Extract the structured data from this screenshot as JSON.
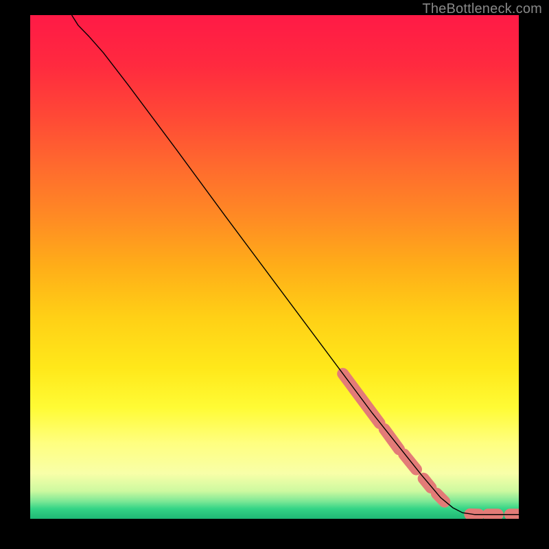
{
  "attribution": "TheBottleneck.com",
  "chart_data": {
    "type": "line",
    "title": "",
    "xlabel": "",
    "ylabel": "",
    "xlim": [
      0,
      100
    ],
    "ylim": [
      0,
      100
    ],
    "background_gradient": {
      "stops": [
        {
          "offset": 0.0,
          "color": "#ff1a46"
        },
        {
          "offset": 0.1,
          "color": "#ff2a3f"
        },
        {
          "offset": 0.2,
          "color": "#ff4836"
        },
        {
          "offset": 0.3,
          "color": "#ff6a2e"
        },
        {
          "offset": 0.4,
          "color": "#ff8a24"
        },
        {
          "offset": 0.5,
          "color": "#ffae18"
        },
        {
          "offset": 0.6,
          "color": "#ffd016"
        },
        {
          "offset": 0.7,
          "color": "#ffe81a"
        },
        {
          "offset": 0.78,
          "color": "#fffb35"
        },
        {
          "offset": 0.85,
          "color": "#ffff80"
        },
        {
          "offset": 0.91,
          "color": "#f8ffa8"
        },
        {
          "offset": 0.945,
          "color": "#cdf9a0"
        },
        {
          "offset": 0.965,
          "color": "#7ee896"
        },
        {
          "offset": 0.98,
          "color": "#34d486"
        },
        {
          "offset": 1.0,
          "color": "#1fb875"
        }
      ]
    },
    "series": [
      {
        "name": "bottleneck-curve",
        "color": "#000000",
        "width": 1.4,
        "points": [
          {
            "x": 8.5,
            "y": 100.0
          },
          {
            "x": 9.8,
            "y": 98.0
          },
          {
            "x": 12.0,
            "y": 95.8
          },
          {
            "x": 15.0,
            "y": 92.5
          },
          {
            "x": 20.0,
            "y": 86.2
          },
          {
            "x": 30.0,
            "y": 73.2
          },
          {
            "x": 40.0,
            "y": 60.0
          },
          {
            "x": 50.0,
            "y": 47.0
          },
          {
            "x": 60.0,
            "y": 34.0
          },
          {
            "x": 70.0,
            "y": 21.0
          },
          {
            "x": 80.0,
            "y": 8.8
          },
          {
            "x": 84.0,
            "y": 4.2
          },
          {
            "x": 86.5,
            "y": 2.2
          },
          {
            "x": 88.5,
            "y": 1.2
          },
          {
            "x": 91.0,
            "y": 0.85
          },
          {
            "x": 100.0,
            "y": 0.85
          }
        ]
      }
    ],
    "markers": {
      "name": "highlighted-segments",
      "color": "#e37b77",
      "radius_px": 8.5,
      "segments": [
        {
          "x1": 64.0,
          "y1": 28.8,
          "x2": 71.5,
          "y2": 19.0
        },
        {
          "x1": 72.5,
          "y1": 17.8,
          "x2": 75.5,
          "y2": 13.8
        },
        {
          "x1": 76.5,
          "y1": 12.8,
          "x2": 79.0,
          "y2": 9.8
        },
        {
          "x1": 80.5,
          "y1": 8.0,
          "x2": 82.0,
          "y2": 6.2
        },
        {
          "x1": 83.2,
          "y1": 5.0,
          "x2": 84.8,
          "y2": 3.4
        },
        {
          "x1": 90.0,
          "y1": 0.9,
          "x2": 91.8,
          "y2": 0.85
        },
        {
          "x1": 93.7,
          "y1": 0.85,
          "x2": 95.7,
          "y2": 0.85
        },
        {
          "x1": 98.2,
          "y1": 0.85,
          "x2": 100.0,
          "y2": 0.85
        }
      ]
    }
  }
}
